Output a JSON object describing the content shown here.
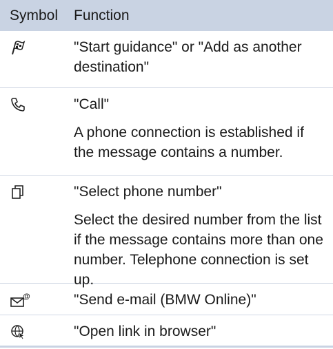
{
  "header": {
    "col_symbol": "Symbol",
    "col_function": "Function"
  },
  "rows": [
    {
      "icon": "destination-flag-icon",
      "function": "\"Start guidance\" or \"Add as another destination\"",
      "note": ""
    },
    {
      "icon": "phone-handset-icon",
      "function": "\"Call\"",
      "note": "A phone connection is established if the message contains a number."
    },
    {
      "icon": "phone-list-icon",
      "function": "\"Select phone number\"",
      "note": "Select the desired number from the list if the message contains more than one number. Telephone connection is set up."
    },
    {
      "icon": "email-at-icon",
      "function": "\"Send e-mail (BMW Online)\"",
      "note": ""
    },
    {
      "icon": "globe-cursor-icon",
      "function": "\"Open link in browser\"",
      "note": ""
    }
  ]
}
